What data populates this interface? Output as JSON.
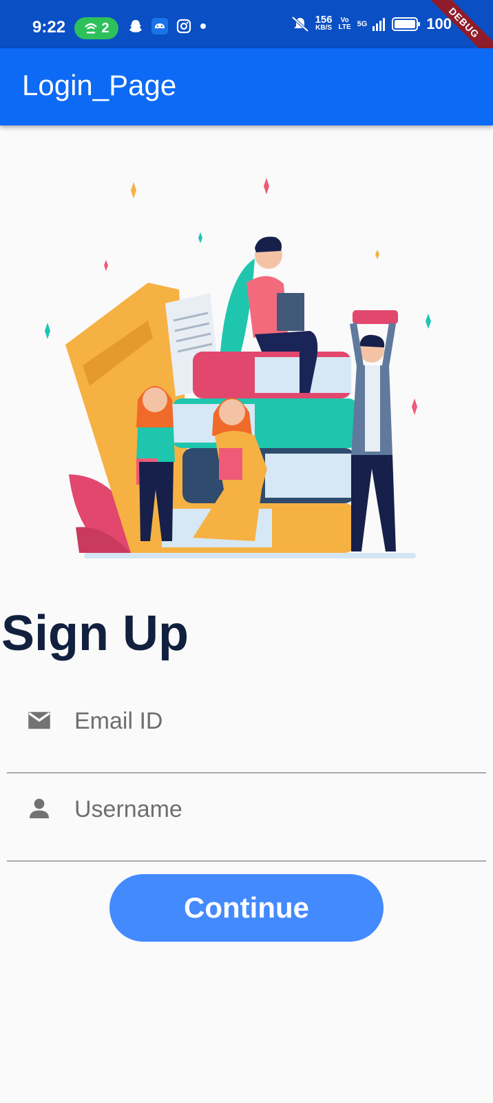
{
  "status_bar": {
    "time": "9:22",
    "hotspot_count": "2",
    "net_speed_value": "156",
    "net_speed_unit": "KB/S",
    "volte": "Vo LTE",
    "network": "5G",
    "battery": "100"
  },
  "debug_banner": "DEBUG",
  "app_bar": {
    "title": "Login_Page"
  },
  "main": {
    "heading": "Sign Up",
    "email_field": {
      "placeholder": "Email ID",
      "icon": "email-icon"
    },
    "username_field": {
      "placeholder": "Username",
      "icon": "person-icon"
    },
    "continue_label": "Continue"
  },
  "colors": {
    "status_bar": "#0a4fc4",
    "app_bar": "#0d6af5",
    "button": "#448aff",
    "heading": "#12203f"
  }
}
